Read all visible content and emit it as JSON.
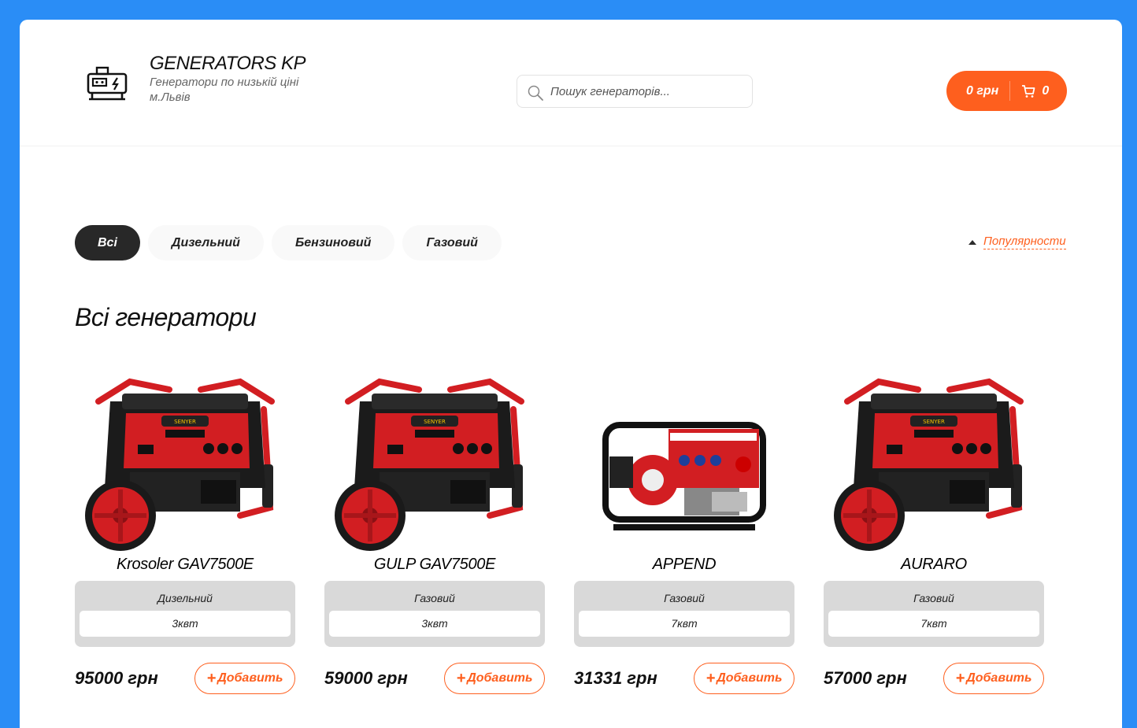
{
  "brand": {
    "title": "GENERATORS KP",
    "subtitle": "Генератори по низькій ціні м.Львів",
    "logo_icon": "generator-icon"
  },
  "search": {
    "placeholder": "Пошук генераторів...",
    "value": ""
  },
  "cart": {
    "price": "0 грн",
    "count": "0"
  },
  "filters": [
    {
      "label": "Всі",
      "active": true
    },
    {
      "label": "Дизельний",
      "active": false
    },
    {
      "label": "Бензиновий",
      "active": false
    },
    {
      "label": "Газовий",
      "active": false
    }
  ],
  "sort": {
    "label": "Популярности"
  },
  "section_title": "Всі генератори",
  "add_label": "Добавить",
  "products": [
    {
      "name": "Krosoler GAV7500E",
      "type": "Дизельний",
      "power": "3квт",
      "price": "95000 грн",
      "image": "red-generator-wheels"
    },
    {
      "name": "GULP GAV7500E",
      "type": "Газовий",
      "power": "3квт",
      "price": "59000 грн",
      "image": "red-generator-wheels"
    },
    {
      "name": "APPEND",
      "type": "Газовий",
      "power": "7квт",
      "price": "31331 грн",
      "image": "red-generator-frame"
    },
    {
      "name": "AURARO",
      "type": "Газовий",
      "power": "7квт",
      "price": "57000 грн",
      "image": "red-generator-wheels"
    }
  ],
  "colors": {
    "accent": "#fe5f1e",
    "background": "#2a8df6",
    "active_pill": "#282828"
  }
}
